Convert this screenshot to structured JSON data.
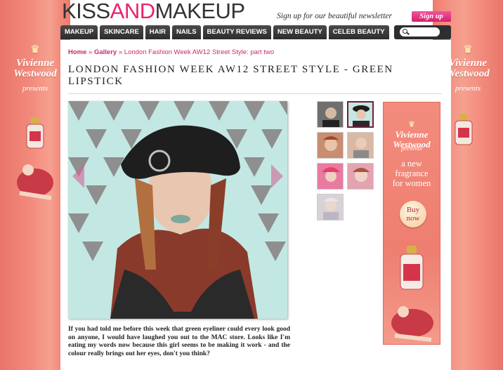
{
  "header": {
    "logo_part1": "KISS",
    "logo_part2": "AND",
    "logo_part3": "MAKEUP",
    "newsletter_text": "Sign up for our beautiful newsletter",
    "signup_label": "Sign up"
  },
  "nav": {
    "items": [
      "MAKEUP",
      "SKINCARE",
      "HAIR",
      "NAILS",
      "BEAUTY REVIEWS",
      "NEW BEAUTY",
      "CELEB BEAUTY"
    ],
    "search_placeholder": ""
  },
  "breadcrumb": {
    "home": "Home",
    "sep1": "»",
    "gallery": "Gallery",
    "sep2": "»",
    "current": "London Fashion Week AW12 Street Style: part two"
  },
  "article": {
    "title": "LONDON FASHION WEEK AW12 STREET STYLE - GREEN LIPSTICK",
    "body": "If you had told me before this week that green eyeliner could every look good on anyone, I would have laughed you out to the MAC store. Looks like I'm eating my words now because this girl seems to be making it work - and the colour really brings out her eyes, don't you think?"
  },
  "side_ad": {
    "brand_line1": "Vivienne",
    "brand_line2": "Westwood",
    "presents": "presents"
  },
  "banner_ad": {
    "brand_line1": "Vivienne",
    "brand_line2": "Westwood",
    "presents": "presents",
    "tagline_line1": "a new",
    "tagline_line2": "fragrance",
    "tagline_line3": "for women",
    "buy_line1": "Buy",
    "buy_line2": "now"
  },
  "colors": {
    "accent_pink": "#e8246f",
    "breadcrumb": "#c82a6e",
    "nav_bg": "#333333",
    "ad_coral": "#f28a7c"
  },
  "icons": {
    "search": "search-icon",
    "prev": "arrow-left-icon",
    "next": "arrow-right-icon"
  }
}
